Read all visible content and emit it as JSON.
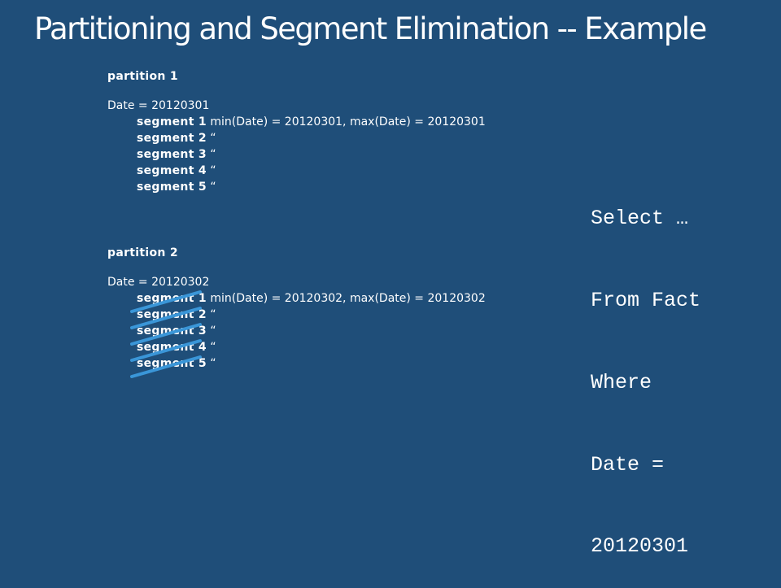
{
  "slide": {
    "title": "Partitioning and Segment Elimination -- Example",
    "background_color": "#1F4E79",
    "strike_color": "#3A96D8"
  },
  "partitions": [
    {
      "label": "partition 1",
      "date_line": "Date = 20120301",
      "segments": [
        {
          "label": "segment 1",
          "detail": "min(Date) = 20120301, max(Date) = 20120301",
          "eliminated": false
        },
        {
          "label": "segment 2",
          "detail": "“",
          "eliminated": false
        },
        {
          "label": "segment 3",
          "detail": "“",
          "eliminated": false
        },
        {
          "label": "segment 4",
          "detail": "“",
          "eliminated": false
        },
        {
          "label": "segment 5",
          "detail": "“",
          "eliminated": false
        }
      ]
    },
    {
      "label": "partition 2",
      "date_line": "Date = 20120302",
      "segments": [
        {
          "label": "segment 1",
          "detail": "min(Date) = 20120302, max(Date) = 20120302",
          "eliminated": true
        },
        {
          "label": "segment 2",
          "detail": "“",
          "eliminated": true
        },
        {
          "label": "segment 3",
          "detail": "“",
          "eliminated": true
        },
        {
          "label": "segment 4",
          "detail": "“",
          "eliminated": true
        },
        {
          "label": "segment 5",
          "detail": "“",
          "eliminated": true
        }
      ]
    }
  ],
  "query": {
    "lines": [
      "Select …",
      "From Fact",
      "Where",
      "Date =",
      "20120301"
    ]
  }
}
